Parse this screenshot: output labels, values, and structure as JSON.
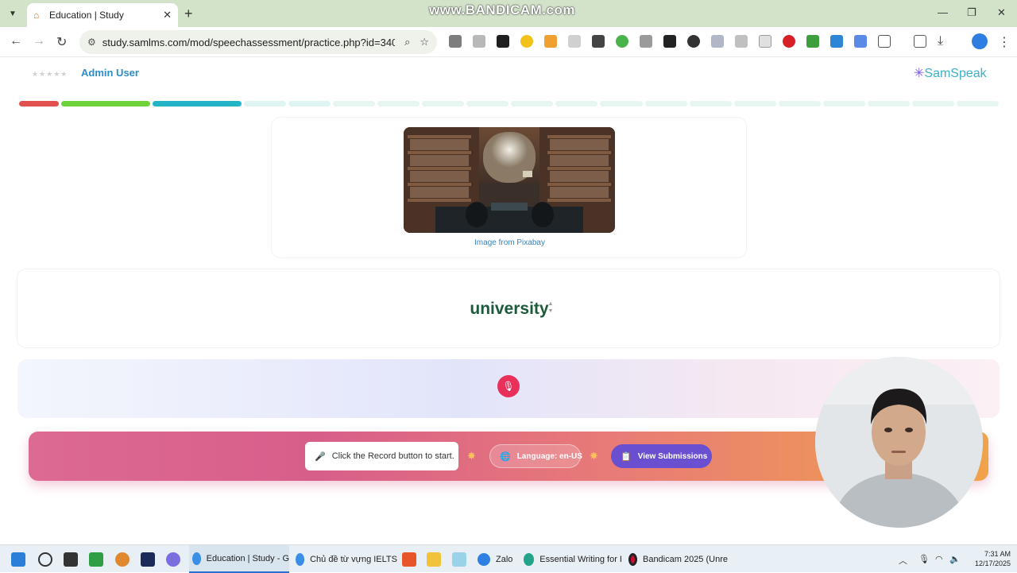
{
  "browser": {
    "tab_title": "Education | Study",
    "url": "study.samlms.com/mod/speechassessment/practice.php?id=340&...",
    "watermark": "www.BANDICAM.com"
  },
  "header": {
    "user_name": "Admin User",
    "stars": "★★★★★",
    "logo_text": "SamSpeak",
    "logo_mark": "✳"
  },
  "progress": {
    "completed_segments": 3,
    "total_segments": 20
  },
  "image_card": {
    "caption": "Image from Pixabay"
  },
  "word_card": {
    "word": "university"
  },
  "status_bar": {
    "hint": "Click the Record button to start.",
    "language": "Language: en-US",
    "view_submissions": "View Submissions"
  },
  "taskbar": {
    "apps": [
      {
        "label": "Education | Study - G"
      },
      {
        "label": "Chủ đề từ vựng IELTS"
      },
      {
        "label": "Zalo"
      },
      {
        "label": "Essential Writing for I"
      },
      {
        "label": "Bandicam 2025 (Unre"
      }
    ],
    "time": "7:31 AM",
    "date": "12/17/2025"
  },
  "colors": {
    "accent_blue": "#2b8dc8",
    "word_green": "#1d5a3a",
    "record_red": "#e8305a",
    "view_purple": "#6a4fd0"
  }
}
